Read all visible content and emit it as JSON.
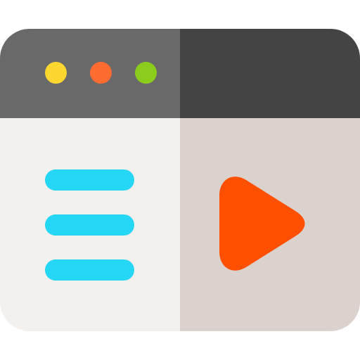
{
  "colors": {
    "titlebar_left": "#696969",
    "titlebar_right": "#444444",
    "body_left": "#f4f0ed",
    "body_right": "#dbd2ce",
    "dot_yellow": "#fdd730",
    "dot_orange": "#ff6b30",
    "dot_green": "#8ccc1c",
    "line_cyan": "#23d7f5",
    "play_orange": "#ff5000"
  },
  "window": {
    "dots": [
      "yellow-dot",
      "orange-dot",
      "green-dot"
    ],
    "menu_lines": 3,
    "play_icon": "play-icon"
  }
}
